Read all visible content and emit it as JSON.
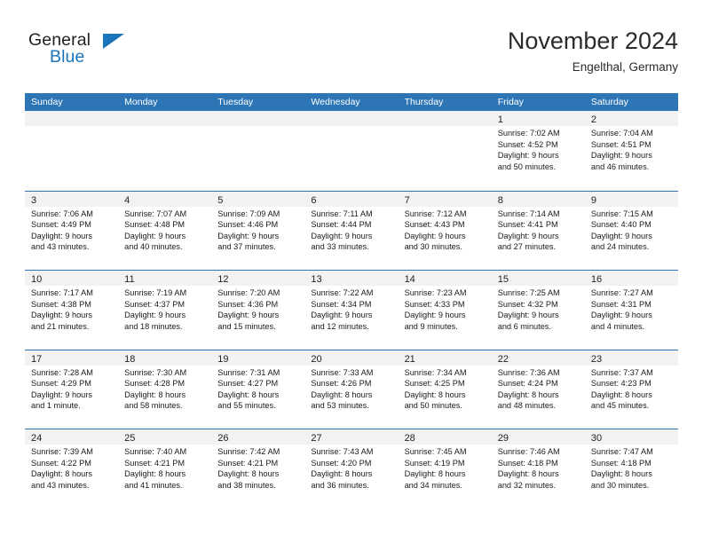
{
  "brand": {
    "name_top": "General",
    "name_bottom": "Blue",
    "accent_color": "#1b75bb",
    "text_color": "#231f20"
  },
  "header": {
    "title": "November 2024",
    "subtitle": "Engelthal, Germany"
  },
  "theme": {
    "header_row_bg": "#2e75b6",
    "day_band_bg": "#f2f2f2",
    "grid_line": "#2e75b6",
    "page_bg": "#ffffff"
  },
  "weekdays": [
    "Sunday",
    "Monday",
    "Tuesday",
    "Wednesday",
    "Thursday",
    "Friday",
    "Saturday"
  ],
  "weeks": [
    [
      {
        "day": "",
        "empty": true
      },
      {
        "day": "",
        "empty": true
      },
      {
        "day": "",
        "empty": true
      },
      {
        "day": "",
        "empty": true
      },
      {
        "day": "",
        "empty": true
      },
      {
        "day": "1",
        "sunrise": "Sunrise: 7:02 AM",
        "sunset": "Sunset: 4:52 PM",
        "daylight1": "Daylight: 9 hours",
        "daylight2": "and 50 minutes."
      },
      {
        "day": "2",
        "sunrise": "Sunrise: 7:04 AM",
        "sunset": "Sunset: 4:51 PM",
        "daylight1": "Daylight: 9 hours",
        "daylight2": "and 46 minutes."
      }
    ],
    [
      {
        "day": "3",
        "sunrise": "Sunrise: 7:06 AM",
        "sunset": "Sunset: 4:49 PM",
        "daylight1": "Daylight: 9 hours",
        "daylight2": "and 43 minutes."
      },
      {
        "day": "4",
        "sunrise": "Sunrise: 7:07 AM",
        "sunset": "Sunset: 4:48 PM",
        "daylight1": "Daylight: 9 hours",
        "daylight2": "and 40 minutes."
      },
      {
        "day": "5",
        "sunrise": "Sunrise: 7:09 AM",
        "sunset": "Sunset: 4:46 PM",
        "daylight1": "Daylight: 9 hours",
        "daylight2": "and 37 minutes."
      },
      {
        "day": "6",
        "sunrise": "Sunrise: 7:11 AM",
        "sunset": "Sunset: 4:44 PM",
        "daylight1": "Daylight: 9 hours",
        "daylight2": "and 33 minutes."
      },
      {
        "day": "7",
        "sunrise": "Sunrise: 7:12 AM",
        "sunset": "Sunset: 4:43 PM",
        "daylight1": "Daylight: 9 hours",
        "daylight2": "and 30 minutes."
      },
      {
        "day": "8",
        "sunrise": "Sunrise: 7:14 AM",
        "sunset": "Sunset: 4:41 PM",
        "daylight1": "Daylight: 9 hours",
        "daylight2": "and 27 minutes."
      },
      {
        "day": "9",
        "sunrise": "Sunrise: 7:15 AM",
        "sunset": "Sunset: 4:40 PM",
        "daylight1": "Daylight: 9 hours",
        "daylight2": "and 24 minutes."
      }
    ],
    [
      {
        "day": "10",
        "sunrise": "Sunrise: 7:17 AM",
        "sunset": "Sunset: 4:38 PM",
        "daylight1": "Daylight: 9 hours",
        "daylight2": "and 21 minutes."
      },
      {
        "day": "11",
        "sunrise": "Sunrise: 7:19 AM",
        "sunset": "Sunset: 4:37 PM",
        "daylight1": "Daylight: 9 hours",
        "daylight2": "and 18 minutes."
      },
      {
        "day": "12",
        "sunrise": "Sunrise: 7:20 AM",
        "sunset": "Sunset: 4:36 PM",
        "daylight1": "Daylight: 9 hours",
        "daylight2": "and 15 minutes."
      },
      {
        "day": "13",
        "sunrise": "Sunrise: 7:22 AM",
        "sunset": "Sunset: 4:34 PM",
        "daylight1": "Daylight: 9 hours",
        "daylight2": "and 12 minutes."
      },
      {
        "day": "14",
        "sunrise": "Sunrise: 7:23 AM",
        "sunset": "Sunset: 4:33 PM",
        "daylight1": "Daylight: 9 hours",
        "daylight2": "and 9 minutes."
      },
      {
        "day": "15",
        "sunrise": "Sunrise: 7:25 AM",
        "sunset": "Sunset: 4:32 PM",
        "daylight1": "Daylight: 9 hours",
        "daylight2": "and 6 minutes."
      },
      {
        "day": "16",
        "sunrise": "Sunrise: 7:27 AM",
        "sunset": "Sunset: 4:31 PM",
        "daylight1": "Daylight: 9 hours",
        "daylight2": "and 4 minutes."
      }
    ],
    [
      {
        "day": "17",
        "sunrise": "Sunrise: 7:28 AM",
        "sunset": "Sunset: 4:29 PM",
        "daylight1": "Daylight: 9 hours",
        "daylight2": "and 1 minute."
      },
      {
        "day": "18",
        "sunrise": "Sunrise: 7:30 AM",
        "sunset": "Sunset: 4:28 PM",
        "daylight1": "Daylight: 8 hours",
        "daylight2": "and 58 minutes."
      },
      {
        "day": "19",
        "sunrise": "Sunrise: 7:31 AM",
        "sunset": "Sunset: 4:27 PM",
        "daylight1": "Daylight: 8 hours",
        "daylight2": "and 55 minutes."
      },
      {
        "day": "20",
        "sunrise": "Sunrise: 7:33 AM",
        "sunset": "Sunset: 4:26 PM",
        "daylight1": "Daylight: 8 hours",
        "daylight2": "and 53 minutes."
      },
      {
        "day": "21",
        "sunrise": "Sunrise: 7:34 AM",
        "sunset": "Sunset: 4:25 PM",
        "daylight1": "Daylight: 8 hours",
        "daylight2": "and 50 minutes."
      },
      {
        "day": "22",
        "sunrise": "Sunrise: 7:36 AM",
        "sunset": "Sunset: 4:24 PM",
        "daylight1": "Daylight: 8 hours",
        "daylight2": "and 48 minutes."
      },
      {
        "day": "23",
        "sunrise": "Sunrise: 7:37 AM",
        "sunset": "Sunset: 4:23 PM",
        "daylight1": "Daylight: 8 hours",
        "daylight2": "and 45 minutes."
      }
    ],
    [
      {
        "day": "24",
        "sunrise": "Sunrise: 7:39 AM",
        "sunset": "Sunset: 4:22 PM",
        "daylight1": "Daylight: 8 hours",
        "daylight2": "and 43 minutes."
      },
      {
        "day": "25",
        "sunrise": "Sunrise: 7:40 AM",
        "sunset": "Sunset: 4:21 PM",
        "daylight1": "Daylight: 8 hours",
        "daylight2": "and 41 minutes."
      },
      {
        "day": "26",
        "sunrise": "Sunrise: 7:42 AM",
        "sunset": "Sunset: 4:21 PM",
        "daylight1": "Daylight: 8 hours",
        "daylight2": "and 38 minutes."
      },
      {
        "day": "27",
        "sunrise": "Sunrise: 7:43 AM",
        "sunset": "Sunset: 4:20 PM",
        "daylight1": "Daylight: 8 hours",
        "daylight2": "and 36 minutes."
      },
      {
        "day": "28",
        "sunrise": "Sunrise: 7:45 AM",
        "sunset": "Sunset: 4:19 PM",
        "daylight1": "Daylight: 8 hours",
        "daylight2": "and 34 minutes."
      },
      {
        "day": "29",
        "sunrise": "Sunrise: 7:46 AM",
        "sunset": "Sunset: 4:18 PM",
        "daylight1": "Daylight: 8 hours",
        "daylight2": "and 32 minutes."
      },
      {
        "day": "30",
        "sunrise": "Sunrise: 7:47 AM",
        "sunset": "Sunset: 4:18 PM",
        "daylight1": "Daylight: 8 hours",
        "daylight2": "and 30 minutes."
      }
    ]
  ]
}
